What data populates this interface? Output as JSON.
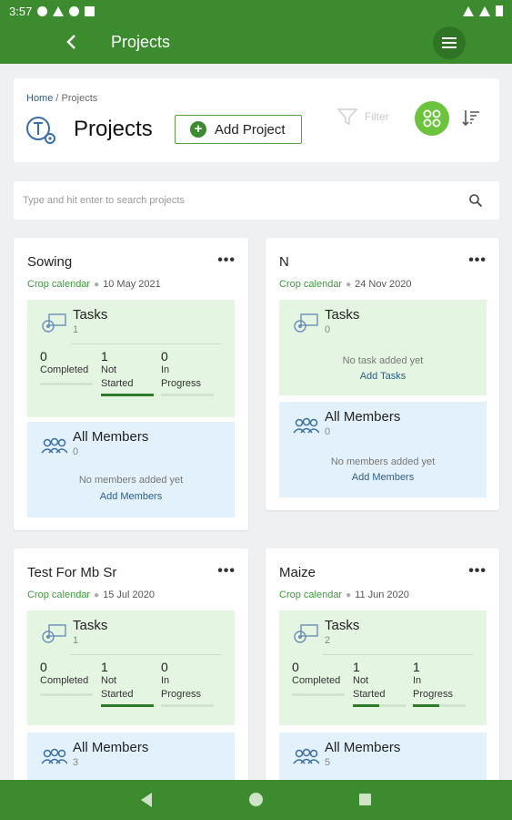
{
  "status_bar": {
    "time": "3:57"
  },
  "app_bar": {
    "title": "Projects"
  },
  "header": {
    "breadcrumb_home": "Home",
    "breadcrumb_sep": " / ",
    "breadcrumb_current": "Projects",
    "title": "Projects",
    "add_button_label": "Add Project",
    "filter_label": "Filter"
  },
  "search": {
    "placeholder": "Type and hit enter to search projects"
  },
  "labels": {
    "tag": "Crop calendar",
    "tasks": "Tasks",
    "all_members": "All Members",
    "completed": "Completed",
    "not_started_1": "Not",
    "not_started_2": "Started",
    "in_progress_1": "In",
    "in_progress_2": "Progress",
    "no_tasks": "No task added yet",
    "add_tasks": "Add Tasks",
    "no_members": "No members added yet",
    "add_members": "Add Members",
    "more": "•••"
  },
  "projects": [
    {
      "name": "Sowing",
      "date": "10 May 2021",
      "tasks_count": "1",
      "completed": "0",
      "not_started": "1",
      "in_progress": "0",
      "progress": {
        "completed": 0,
        "not_started": 1,
        "in_progress": 0
      },
      "members_count": "0"
    },
    {
      "name": "N",
      "date": "24 Nov 2020",
      "tasks_count": "0",
      "members_count": "0"
    },
    {
      "name": "Test For Mb Sr",
      "date": "15 Jul 2020",
      "tasks_count": "1",
      "completed": "0",
      "not_started": "1",
      "in_progress": "0",
      "progress": {
        "completed": 0,
        "not_started": 1,
        "in_progress": 0
      },
      "members_count": "3"
    },
    {
      "name": "Maize",
      "date": "11 Jun 2020",
      "tasks_count": "2",
      "completed": "0",
      "not_started": "1",
      "in_progress": "1",
      "progress": {
        "completed": 0,
        "not_started": 0.5,
        "in_progress": 0.5
      },
      "members_count": "5"
    }
  ],
  "colors": {
    "primary": "#3d8b2f",
    "accent_button": "#6cc43c",
    "tasks_bg": "#e4f6e1",
    "members_bg": "#e2f1fc",
    "link": "#2d5d8a",
    "tag": "#3d9a3a"
  }
}
